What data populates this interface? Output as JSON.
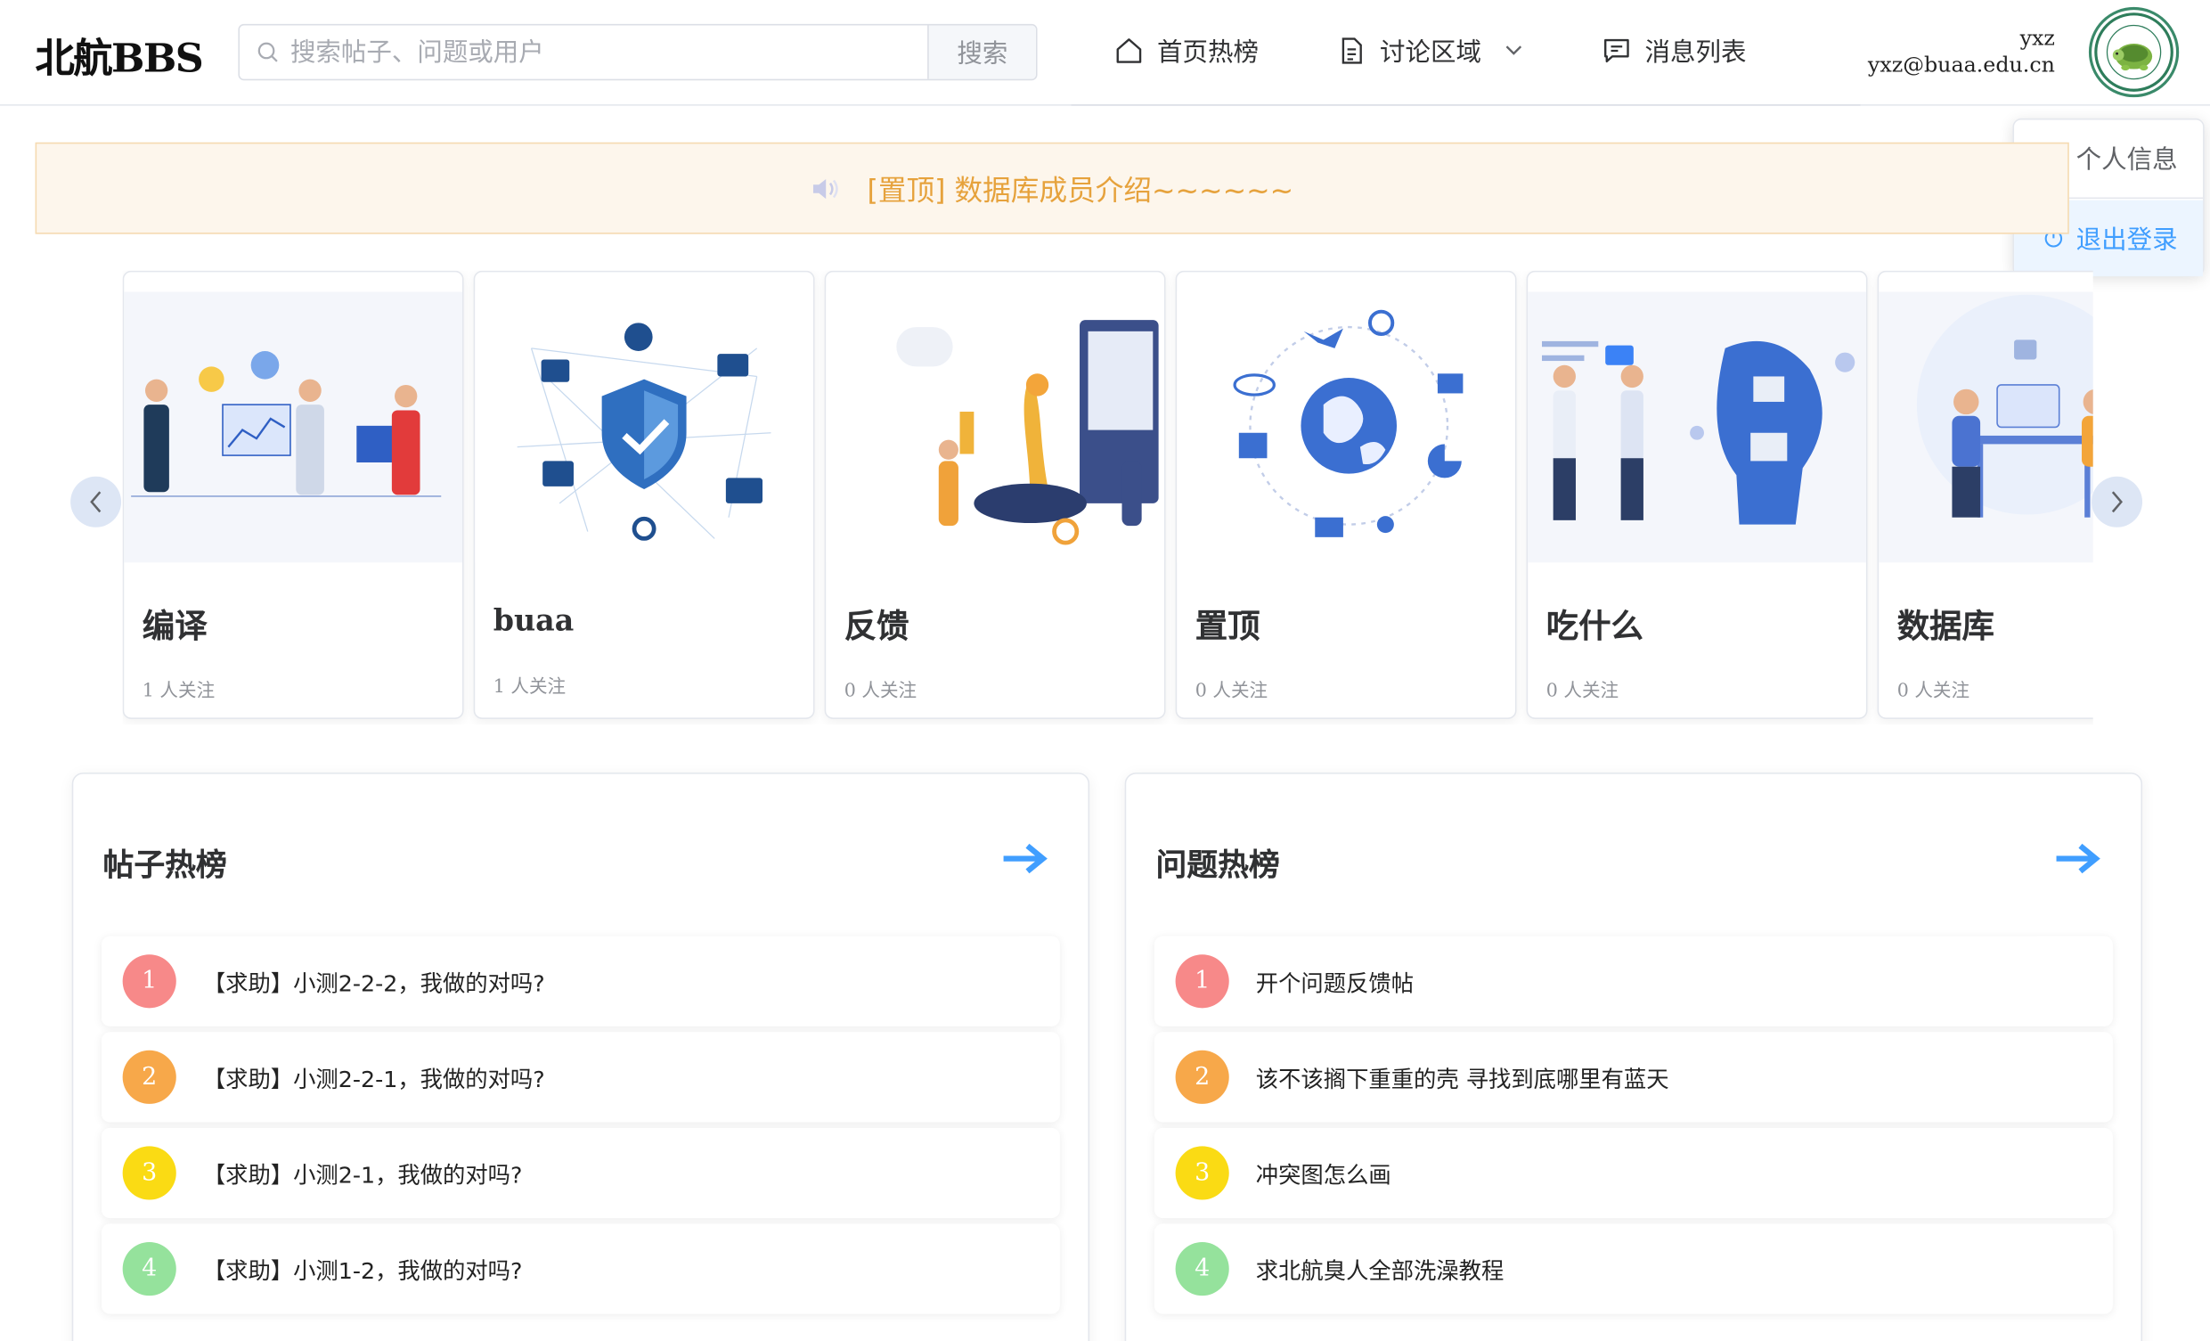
{
  "header": {
    "logo": "北航BBS",
    "search_placeholder": "搜索帖子、问题或用户",
    "search_button": "搜索",
    "nav": {
      "home": "首页热榜",
      "discussion": "讨论区域",
      "messages": "消息列表"
    },
    "user": {
      "name": "yxz",
      "email": "yxz@buaa.edu.cn"
    }
  },
  "dropdown": {
    "profile": "个人信息",
    "logout": "退出登录"
  },
  "notice": {
    "text": "[置顶] 数据库成员介绍~~~~~~"
  },
  "cards": [
    {
      "name": "编译",
      "followers": "1 人关注"
    },
    {
      "name": "buaa",
      "followers": "1 人关注"
    },
    {
      "name": "反馈",
      "followers": "0 人关注"
    },
    {
      "name": "置顶",
      "followers": "0 人关注"
    },
    {
      "name": "吃什么",
      "followers": "0 人关注"
    },
    {
      "name": "数据库",
      "followers": "0 人关注"
    }
  ],
  "posts_board": {
    "title": "帖子热榜",
    "items": [
      {
        "rank": "1",
        "text": "【求助】小测2-2-2，我做的对吗?"
      },
      {
        "rank": "2",
        "text": "【求助】小测2-2-1，我做的对吗?"
      },
      {
        "rank": "3",
        "text": "【求助】小测2-1，我做的对吗?"
      },
      {
        "rank": "4",
        "text": "【求助】小测1-2，我做的对吗?"
      }
    ]
  },
  "questions_board": {
    "title": "问题热榜",
    "items": [
      {
        "rank": "1",
        "text": "开个问题反馈帖"
      },
      {
        "rank": "2",
        "text": "该不该搁下重重的壳 寻找到底哪里有蓝天"
      },
      {
        "rank": "3",
        "text": "冲突图怎么画"
      },
      {
        "rank": "4",
        "text": "求北航臭人全部洗澡教程"
      }
    ]
  },
  "colors": {
    "accent": "#409eff",
    "rank1": "#f78989",
    "rank2": "#f7a84a",
    "rank3": "#fadb14",
    "rank4": "#95e29c",
    "notice_text": "#e6a23c"
  }
}
